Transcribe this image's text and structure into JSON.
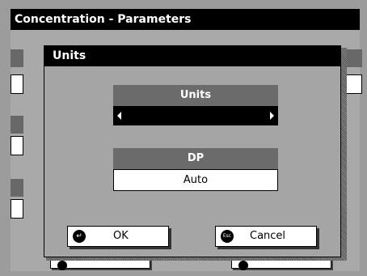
{
  "background_window": {
    "title": "Concentration - Parameters"
  },
  "dialog": {
    "title": "Units",
    "units_field": {
      "label": "Units",
      "value": ""
    },
    "dp_field": {
      "label": "DP",
      "value": "Auto"
    },
    "buttons": {
      "ok": {
        "label": "OK",
        "icon": "enter-icon"
      },
      "cancel": {
        "label": "Cancel",
        "icon": "esc-icon",
        "icon_text": "Esc"
      }
    }
  },
  "colors": {
    "title_bar": "#000000",
    "field_header": "#6b6b6b",
    "dialog_body": "#a5a5a5"
  }
}
